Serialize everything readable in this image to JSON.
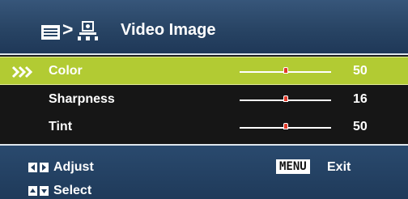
{
  "header": {
    "title": "Video Image",
    "breadcrumb_separator": ">",
    "menu_icon": "menu-list-icon",
    "section_icon": "video-image-icon"
  },
  "items": [
    {
      "label": "Color",
      "value": "50",
      "level": 0.5,
      "selected": true
    },
    {
      "label": "Sharpness",
      "value": "16",
      "level": 0.5,
      "selected": false
    },
    {
      "label": "Tint",
      "value": "50",
      "level": 0.5,
      "selected": false
    }
  ],
  "footer": {
    "adjust_label": "Adjust",
    "select_label": "Select",
    "menu_key_label": "MENU",
    "exit_label": "Exit"
  },
  "colors": {
    "header": "#284464",
    "selected_row": "#b2cb33",
    "list_background": "#161616",
    "slider_thumb": "#e23a2a"
  }
}
